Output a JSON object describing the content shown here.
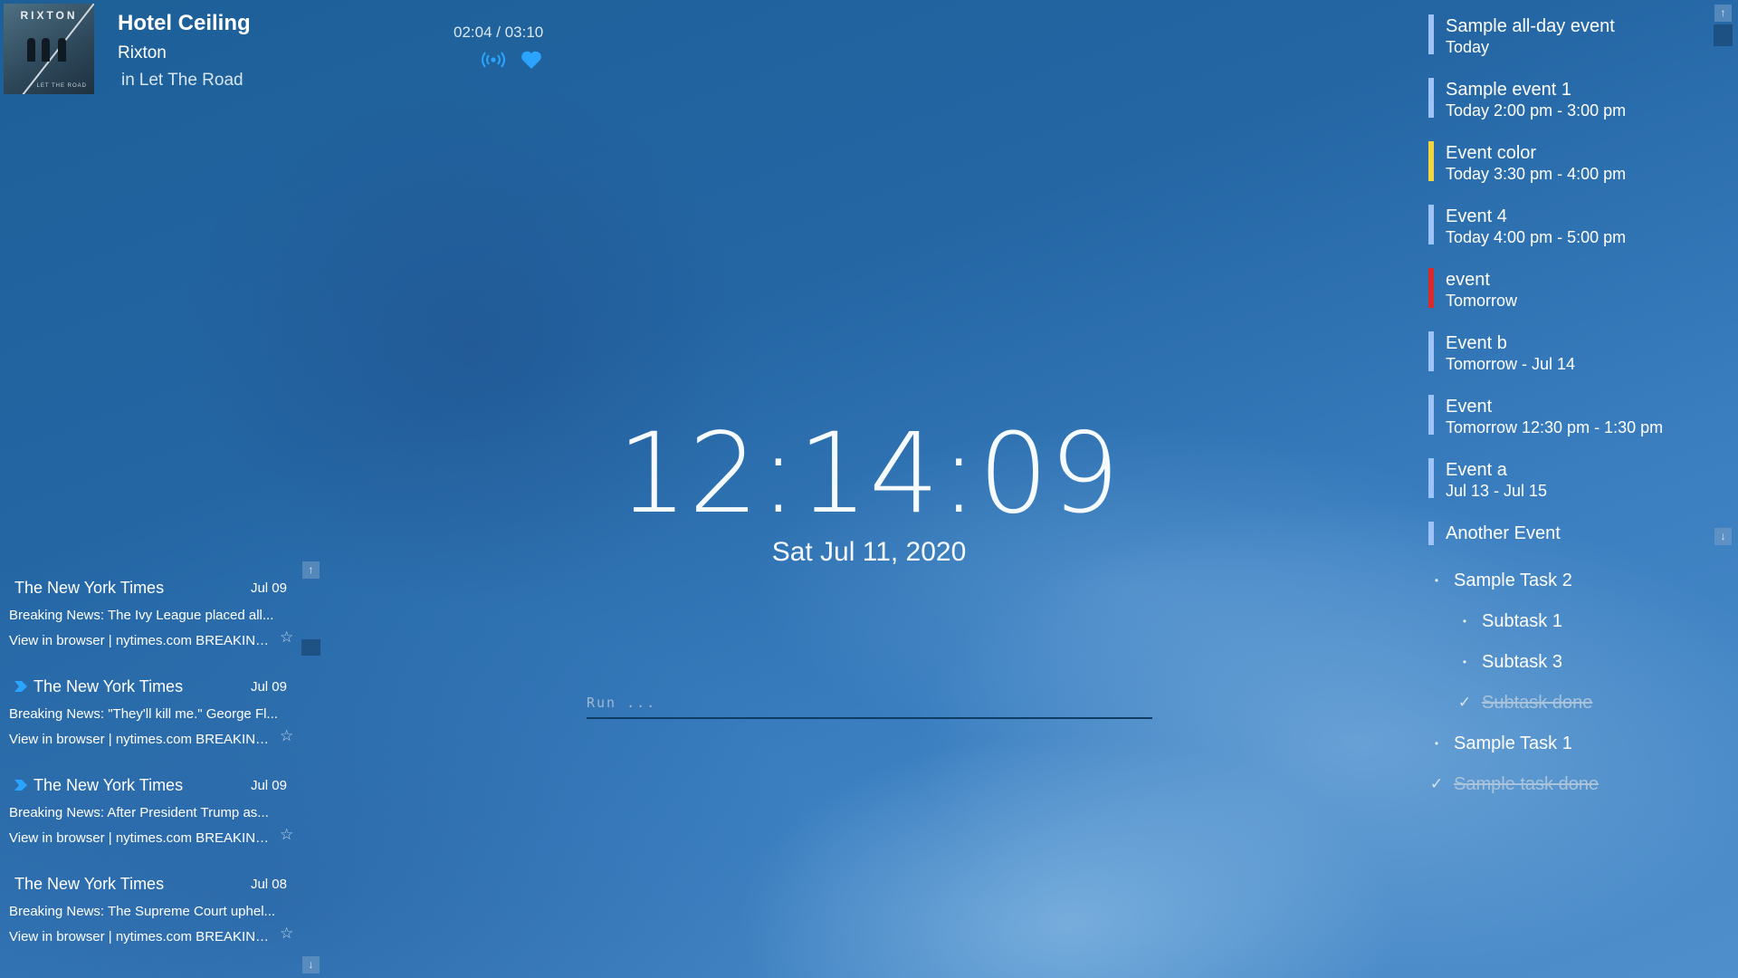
{
  "music": {
    "album_art": {
      "band": "RIXTON",
      "subtitle": "LET THE ROAD"
    },
    "title": "Hotel Ceiling",
    "artist": "Rixton",
    "album_prefix": "in",
    "album": "Let The Road",
    "time": "02:04 / 03:10",
    "controls": {
      "cast_icon": "cast-icon",
      "like_icon": "heart-icon"
    }
  },
  "clock": {
    "time": "12:14:09",
    "date": "Sat Jul 11, 2020"
  },
  "run": {
    "placeholder": "Run ..."
  },
  "feed": {
    "items": [
      {
        "source": "The New York Times",
        "date": "Jul 09",
        "subject": "Breaking News: The Ivy League placed all...",
        "snippet": "View in browser | nytimes.com BREAKING...",
        "marked": false
      },
      {
        "source": "The New York Times",
        "date": "Jul 09",
        "subject": "Breaking News: \"They'll kill me.\" George Fl...",
        "snippet": "View in browser | nytimes.com BREAKING...",
        "marked": true
      },
      {
        "source": "The New York Times",
        "date": "Jul 09",
        "subject": "Breaking News: After President Trump as...",
        "snippet": "View in browser | nytimes.com BREAKING...",
        "marked": true
      },
      {
        "source": "The New York Times",
        "date": "Jul 08",
        "subject": "Breaking News: The Supreme Court uphel...",
        "snippet": "View in browser | nytimes.com BREAKING...",
        "marked": false
      }
    ],
    "star_icon": "☆",
    "scroll_up": "↑",
    "scroll_down": "↓"
  },
  "agenda": {
    "events": [
      {
        "title": "Sample all-day event",
        "when": "Today",
        "color": "#9ec3f7"
      },
      {
        "title": "Sample event 1",
        "when": "Today 2:00 pm - 3:00 pm",
        "color": "#9ec3f7"
      },
      {
        "title": "Event color",
        "when": "Today 3:30 pm - 4:00 pm",
        "color": "#f5d442"
      },
      {
        "title": "Event 4",
        "when": "Today 4:00 pm - 5:00 pm",
        "color": "#9ec3f7"
      },
      {
        "title": "event",
        "when": "Tomorrow",
        "color": "#d92b2b"
      },
      {
        "title": "Event b",
        "when": "Tomorrow - Jul 14",
        "color": "#9ec3f7"
      },
      {
        "title": "Event",
        "when": "Tomorrow 12:30 pm - 1:30 pm",
        "color": "#9ec3f7"
      },
      {
        "title": "Event a",
        "when": "Jul 13 - Jul 15",
        "color": "#9ec3f7"
      },
      {
        "title": "Another Event",
        "when": "",
        "color": "#9ec3f7"
      }
    ],
    "scroll_up": "↑",
    "scroll_down": "↓"
  },
  "tasks": [
    {
      "label": "Sample Task 2",
      "done": false,
      "level": 0
    },
    {
      "label": "Subtask 1",
      "done": false,
      "level": 1
    },
    {
      "label": "Subtask 3",
      "done": false,
      "level": 1
    },
    {
      "label": "Subtask done",
      "done": true,
      "level": 1
    },
    {
      "label": "Sample Task 1",
      "done": false,
      "level": 0
    },
    {
      "label": "Sample task done",
      "done": true,
      "level": 0
    }
  ],
  "colors": {
    "accent": "#2196f3",
    "cast": "#2aa4ff",
    "heart": "#2aa4ff"
  }
}
